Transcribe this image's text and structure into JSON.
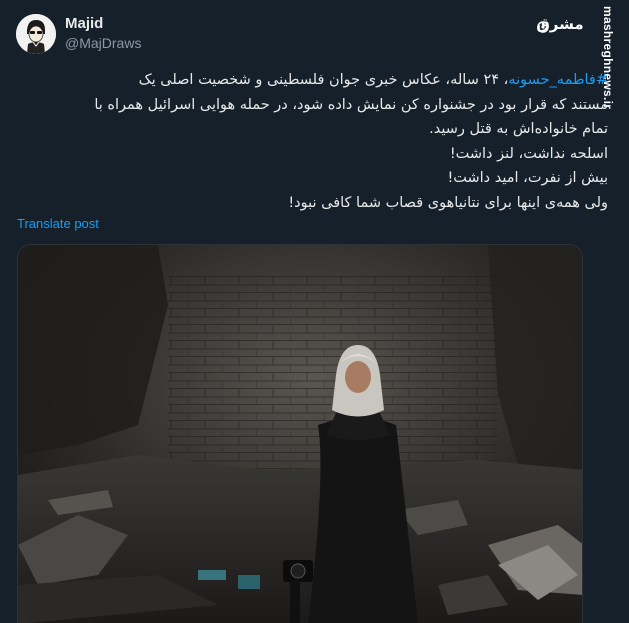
{
  "author": {
    "name": "Majid",
    "handle": "@MajDraws"
  },
  "post": {
    "hashtag": "#فاطمه_حسونه",
    "line1_rest": "، ۲۴ ساله، عکاس خبری جوان فلسطینی و شخصیت اصلی یک",
    "line2": "مستند که قرار بود در جشنواره کن نمایش داده شود، در حمله هوایی اسرائیل همراه با",
    "line3": "تمام خانواده‌اش به قتل رسید.",
    "line4": "اسلحه نداشت، لنز داشت!",
    "line5": "بیش از نفرت، امید داشت!",
    "line6": "ولی همه‌ی اینها برای نتانیاهوی قصاب شما کافی نبود!"
  },
  "translate_label": "Translate post",
  "watermark": {
    "logo_text": "مشرق",
    "site": "mashreghnews.ir"
  },
  "photo": {
    "subject": "woman-with-camera-in-ruins-photo"
  },
  "colors": {
    "background": "#15202b",
    "text": "#e7e9ea",
    "secondary": "#8b98a5",
    "link": "#1d9bf0"
  }
}
